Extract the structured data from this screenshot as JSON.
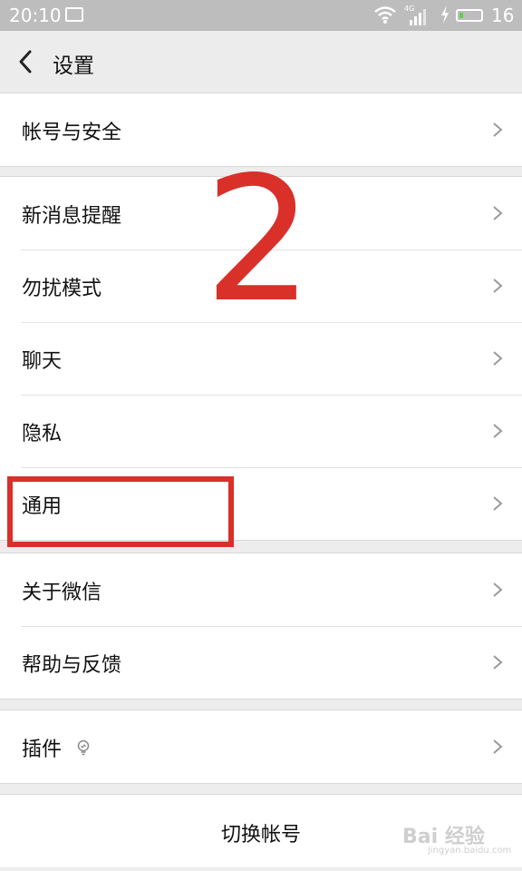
{
  "status_bar": {
    "time": "20:10",
    "network": "4G",
    "battery_level": "16",
    "icons": [
      "notification-icon",
      "wifi-icon",
      "signal-icon",
      "charging-icon",
      "battery-icon"
    ]
  },
  "header": {
    "back_icon": "chevron-left-icon",
    "title": "设置"
  },
  "groups": [
    {
      "items": [
        {
          "label": "帐号与安全"
        }
      ]
    },
    {
      "items": [
        {
          "label": "新消息提醒"
        },
        {
          "label": "勿扰模式"
        },
        {
          "label": "聊天"
        },
        {
          "label": "隐私"
        },
        {
          "label": "通用"
        }
      ]
    },
    {
      "items": [
        {
          "label": "关于微信"
        },
        {
          "label": "帮助与反馈"
        }
      ]
    },
    {
      "items": [
        {
          "label": "插件",
          "icon": "lightbulb-icon"
        }
      ]
    }
  ],
  "switch_account": "切换帐号",
  "annotation": {
    "step_number": "2",
    "color": "#d9302a",
    "highlighted_item": "通用"
  },
  "watermark": {
    "logo_text": "Bai 经验",
    "url": "jingyan.baidu.com"
  },
  "colors": {
    "background": "#ededed",
    "status_bar": "#bdbdbd",
    "battery": "#5ed04b"
  }
}
